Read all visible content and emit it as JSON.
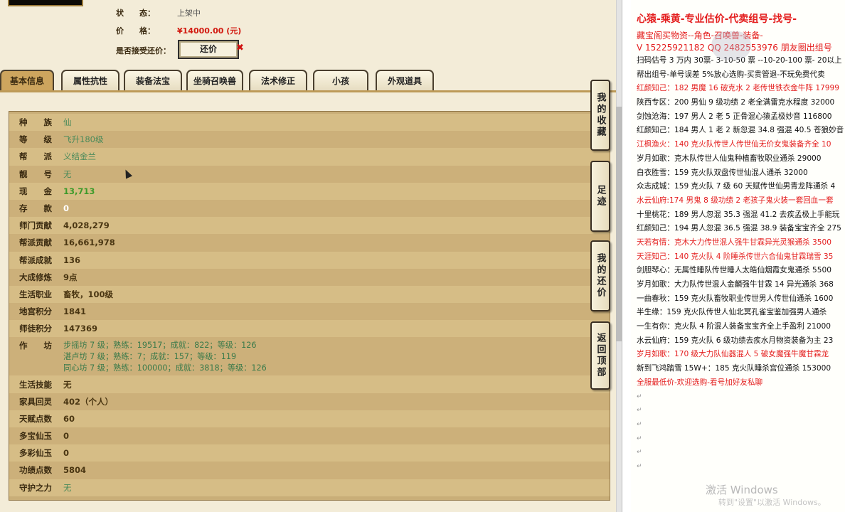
{
  "status": {
    "label": "状　　态：",
    "value": "上架中"
  },
  "price": {
    "label": "价　　格：",
    "value": "¥14000.00 (元)"
  },
  "counter_offer": {
    "label": "是否接受还价：",
    "button": "还价",
    "close": "✖"
  },
  "tabs": [
    "基本信息",
    "属性抗性",
    "装备法宝",
    "坐骑召唤兽",
    "法术修正",
    "小孩",
    "外观道具"
  ],
  "side_buttons": [
    "我的收藏",
    "足迹",
    "我的还价",
    "返回顶部"
  ],
  "info_rows": [
    {
      "k": "种　　族",
      "v": "仙"
    },
    {
      "k": "等　　级",
      "v": "飞升180级"
    },
    {
      "k": "帮　　派",
      "v": "义结金兰"
    },
    {
      "k": "靓　　号",
      "v": "无"
    },
    {
      "k": "现　　金",
      "v": "13,713"
    },
    {
      "k": "存　　款",
      "v": "0"
    },
    {
      "k": "师门贡献",
      "v": "4,028,279"
    },
    {
      "k": "帮派贡献",
      "v": "16,661,978"
    },
    {
      "k": "帮派成就",
      "v": "136"
    },
    {
      "k": "大成修炼",
      "v": "9点"
    },
    {
      "k": "生活职业",
      "v": "畜牧，100级"
    },
    {
      "k": "地宫积分",
      "v": "1841"
    },
    {
      "k": "师徒积分",
      "v": "147369"
    }
  ],
  "workshop": {
    "k": "作　　坊",
    "lines": [
      "步摇坊 7 级；熟练：19517；成就：822；等级：126",
      "湛卢坊 7 级；熟练：7；成就：157；等级：119",
      "同心坊 7 级；熟练：100000；成就：3818；等级：126"
    ]
  },
  "info_rows2": [
    {
      "k": "生活技能",
      "v": "无"
    },
    {
      "k": "家具回灵",
      "v": "402（个人）"
    },
    {
      "k": "天赋点数",
      "v": "60"
    },
    {
      "k": "多宝仙玉",
      "v": "0"
    },
    {
      "k": "多彩仙玉",
      "v": "0"
    },
    {
      "k": "功绩点数",
      "v": "5804"
    },
    {
      "k": "守护之力",
      "v": "无"
    }
  ],
  "doc": {
    "title": "心猿-乘黄-专业估价-代卖组号-找号-",
    "lines": [
      {
        "t": "藏宝阁买物资--角色-召唤兽-装备-",
        "red": true,
        "big": true
      },
      {
        "t": "V 15225921182  QQ 2482553976 朋友圈出组号",
        "red": true,
        "big": true
      },
      {
        "t": "扫码估号 3 万内 30票- 3-10-50 票 --10-20-100 票- 20以上 1",
        "red": false
      },
      {
        "t": "帮出组号-单号误差 5%放心选购-买贵管退-不玩免费代卖",
        "red": false
      },
      {
        "t": "红颜知己：182 男魔 16 破克水 2 老传世铁衣金牛阵 17999",
        "red": true
      },
      {
        "t": "陕西专区：200 男仙 9 级功绩 2 老全满雷克水程度 32000",
        "red": false
      },
      {
        "t": "剑蚀沧海：197 男人 2 老 5 正骨混心猿孟极妙音 116800",
        "red": false
      },
      {
        "t": "红颜知己：184 男人 1 老 2 新忽混 34.8 强混 40.5 苍狼妙音 22",
        "red": false
      },
      {
        "t": "江枫渔火：140 克火队传世人传世仙无价女鬼装备齐全 10",
        "red": true
      },
      {
        "t": "岁月如歌：克木队传世人仙鬼种植畜牧职业通杀 29000",
        "red": false
      },
      {
        "t": "白衣胜雪：159 克火队双盘传世仙混人通杀 32000",
        "red": false
      },
      {
        "t": "众志成城：159 克火队 7 级 60 天赋传世仙男青龙阵通杀 4",
        "red": false
      },
      {
        "t": "水云仙府:174 男鬼 8 级功绩 2 老孩子鬼火装一套回血一套",
        "red": true
      },
      {
        "t": "十里桃花：189 男人忽混 35.3 强混 41.2 去疾孟极上手能玩",
        "red": false
      },
      {
        "t": "红颜知己：194 男人忽混 36.5 强混 38.9 装备宝宝齐全 275",
        "red": false
      },
      {
        "t": "天若有情：克木大力传世混人强牛甘霖异光灵猴通杀 3500",
        "red": true
      },
      {
        "t": "天涯知己：140 克火队 4 阶睡杀传世六合仙鬼甘霖瑞雪 35",
        "red": true
      },
      {
        "t": "剑胆琴心：无属性睡队传世睡人太皓仙烟霞女鬼通杀 5500",
        "red": false
      },
      {
        "t": "岁月如歌：大力队传世混人金麟强牛甘霖 14 异光通杀 368",
        "red": false
      },
      {
        "t": "一曲春秋：159 克火队畜牧职业传世男人传世仙通杀 1600",
        "red": false
      },
      {
        "t": "半生缘：159 克火队传世人仙北冥孔雀宝鉴加强男人通杀",
        "red": false
      },
      {
        "t": "一生有你：克火队 4 阶混人装备宝宝齐全上手盈利 21000",
        "red": false
      },
      {
        "t": "水云仙府：159 克火队 6 级功绩去疾水月物资装备为主 23",
        "red": false
      },
      {
        "t": "岁月如歌：170 级大力队仙器混人 5 破女魔强牛魔甘霖龙",
        "red": true
      },
      {
        "t": "新到飞鸿踏雪 15W+：185 克火队睡杀宫位通杀 153000",
        "red": false
      },
      {
        "t": "全服最低价-欢迎选购-看号加好友私聊",
        "red": true
      }
    ],
    "mark": "↵"
  },
  "watermark": {
    "line1": "激活 Windows",
    "line2": "转到\"设置\"以激活 Windows。"
  }
}
